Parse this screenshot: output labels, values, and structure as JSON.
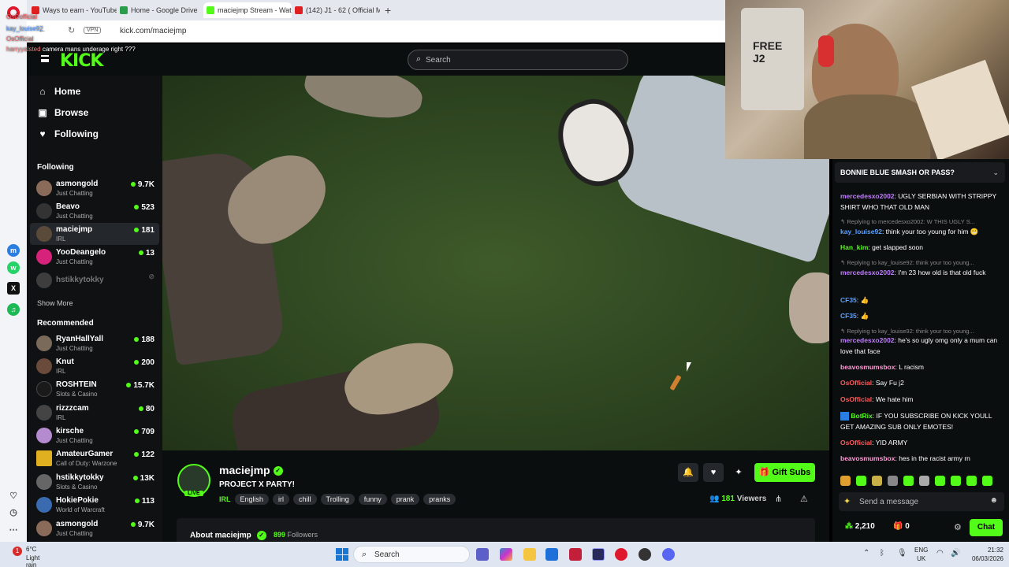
{
  "browser": {
    "tabs": [
      {
        "title": "Ways to earn - YouTube S",
        "color": "#e02020"
      },
      {
        "title": "Home - Google Drive",
        "color": "#2a9d4a"
      },
      {
        "title": "maciejmp Stream - Watch",
        "color": "#53fc18"
      },
      {
        "title": "(142) J1 - 62 ( Official Mu",
        "color": "#e02020"
      }
    ],
    "new_tab": "+",
    "vpn": "VPN",
    "url": "kick.com/maciejmp"
  },
  "overlay_chat": [
    {
      "user": "OsOofficial",
      "text": "",
      "color": "#ff5a5a"
    },
    {
      "user": "kay_louise92",
      "text": "",
      "color": "#5aa0ff"
    },
    {
      "user": "OsOfficial",
      "text": "",
      "color": "#ff5a5a"
    },
    {
      "user": "harryyalsted",
      "text": "camera mans underage right ???",
      "color": "#ff7a7a"
    }
  ],
  "search": {
    "placeholder": "Search"
  },
  "nav": [
    {
      "label": "Home",
      "icon": "⌂"
    },
    {
      "label": "Browse",
      "icon": "▣"
    },
    {
      "label": "Following",
      "icon": "♥"
    }
  ],
  "following_label": "Following",
  "following": [
    {
      "name": "asmongold",
      "category": "Just Chatting",
      "viewers": "9.7K",
      "color": "#8a6b5a"
    },
    {
      "name": "Beavo",
      "category": "Just Chatting",
      "viewers": "523",
      "color": "#333"
    },
    {
      "name": "maciejmp",
      "category": "IRL",
      "viewers": "181",
      "color": "#5a4a3a"
    },
    {
      "name": "YooDeangelo",
      "category": "Just Chatting",
      "viewers": "13",
      "color": "#d6227a"
    },
    {
      "name": "hstikkytokky",
      "category": "",
      "viewers": "",
      "color": "#666"
    }
  ],
  "show_more": "Show More",
  "recommended_label": "Recommended",
  "recommended": [
    {
      "name": "RyanHallYall",
      "category": "Just Chatting",
      "viewers": "188",
      "color": "#7a6a5a"
    },
    {
      "name": "Knut",
      "category": "IRL",
      "viewers": "200",
      "color": "#6a4a3a"
    },
    {
      "name": "ROSHTEIN",
      "category": "Slots & Casino",
      "viewers": "15.7K",
      "color": "#1a1a1a"
    },
    {
      "name": "rizzzcam",
      "category": "IRL",
      "viewers": "80",
      "color": "#444"
    },
    {
      "name": "kirsche",
      "category": "Just Chatting",
      "viewers": "709",
      "color": "#b58bd0"
    },
    {
      "name": "AmateurGamer",
      "category": "Call of Duty: Warzone",
      "viewers": "122",
      "color": "#e0b020"
    },
    {
      "name": "hstikkytokky",
      "category": "Slots & Casino",
      "viewers": "13K",
      "color": "#666"
    },
    {
      "name": "HokiePokie",
      "category": "World of Warcraft",
      "viewers": "113",
      "color": "#3a6ab0"
    },
    {
      "name": "asmongold",
      "category": "Just Chatting",
      "viewers": "9.7K",
      "color": "#8a6b5a"
    }
  ],
  "stream": {
    "live": "LIVE",
    "streamer": "maciejmp",
    "verified": "✓",
    "title": "PROJECT X PARTY!",
    "category": "IRL",
    "tags": [
      "English",
      "irl",
      "chill",
      "Trolling",
      "funny",
      "prank",
      "pranks"
    ],
    "gift_label": "Gift Subs",
    "viewers_count": "181",
    "viewers_label": "Viewers",
    "about_label": "About maciejmp",
    "followers_count": "899",
    "followers_label": "Followers"
  },
  "chat": {
    "pinned": "BONNIE BLUE SMASH OR PASS?",
    "messages": [
      {
        "type": "msg",
        "user": "mercedesxo2002",
        "color": "#c07cff",
        "text": "UGLY SERBIAN WITH STRIPPY SHIRT WHO THAT OLD MAN"
      },
      {
        "type": "reply",
        "text": "Replying to mercedesxo2002: W THIS UGLY S..."
      },
      {
        "type": "msg",
        "user": "kay_louise92",
        "color": "#5aa0ff",
        "text": "think your too young for him 😬"
      },
      {
        "type": "msg",
        "user": "Han_kim",
        "color": "#53fc18",
        "text": "get slapped soon"
      },
      {
        "type": "reply",
        "text": "Replying to kay_louise92: think your too young..."
      },
      {
        "type": "msg",
        "user": "mercedesxo2002",
        "color": "#c07cff",
        "text": "I'm 23 how old is that old fuck"
      },
      {
        "type": "msg",
        "user": "CF35",
        "color": "#5aa0ff",
        "text": "👍"
      },
      {
        "type": "msg",
        "user": "CF35",
        "color": "#5aa0ff",
        "text": "👍"
      },
      {
        "type": "reply",
        "text": "Replying to kay_louise92: think your too young..."
      },
      {
        "type": "msg",
        "user": "mercedesxo2002",
        "color": "#c07cff",
        "text": "he's so ugly omg only a mum can love that face"
      },
      {
        "type": "msg",
        "user": "beavosmumsbox",
        "color": "#ff9ad5",
        "text": "L racism"
      },
      {
        "type": "msg",
        "user": "OsOfficial",
        "color": "#ff5a5a",
        "text": "Say Fu j2"
      },
      {
        "type": "msg",
        "user": "OsOfficial",
        "color": "#ff5a5a",
        "text": "We hate him"
      },
      {
        "type": "msg",
        "user": "BotRix",
        "color": "#53fc18",
        "text": "IF YOU SUBSCRIBE ON KICK YOULL GET AMAZING SUB ONLY EMOTES!"
      },
      {
        "type": "msg",
        "user": "OsOfficial",
        "color": "#ff5a5a",
        "text": "YID ARMY"
      },
      {
        "type": "msg",
        "user": "beavosmumsbox",
        "color": "#ff9ad5",
        "text": "hes in the racist army rn"
      }
    ],
    "input_placeholder": "Send a message",
    "points": "2,210",
    "gifts": "0",
    "chat_button": "Chat"
  },
  "taskbar": {
    "notification_count": "1",
    "temperature": "6°C",
    "weather": "Light rain",
    "search_placeholder": "Search",
    "lang_top": "ENG",
    "lang_bottom": "UK",
    "time": "21:32",
    "date": "06/03/2026"
  }
}
